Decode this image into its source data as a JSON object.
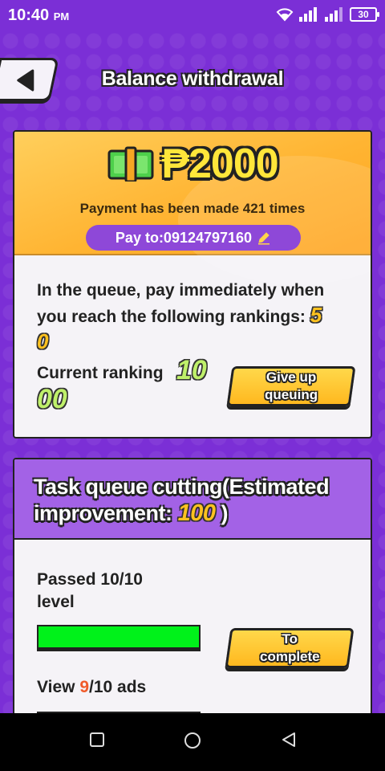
{
  "status_bar": {
    "time": "10:40",
    "ampm": "PM",
    "battery": "30"
  },
  "header": {
    "title": "Balance withdrawal"
  },
  "payment": {
    "amount": "₱2000",
    "count_text": "Payment has been made 421 times",
    "pay_to": "Pay to:09124797160"
  },
  "queue": {
    "text": "In the queue, pay immediately when you reach the following rankings:",
    "target_rank_part1": "5",
    "target_rank_part2": "0",
    "current_label": "Current ranking",
    "current_rank_part1": "10",
    "current_rank_part2": "00",
    "give_up_line1": "Give up",
    "give_up_line2": "queuing"
  },
  "task": {
    "title_text": "Task queue cutting(Estimated improvement:",
    "title_value": "100",
    "title_close": ")",
    "item1_label_line1": "Passed 10/10",
    "item1_label_line2": "level",
    "item1_progress": 1.0,
    "complete_line1": "To",
    "complete_line2": "complete",
    "item2_prefix": "View ",
    "item2_highlight": "9",
    "item2_suffix": "/10 ads",
    "item2_progress": 0.9
  },
  "colors": {
    "background": "#7b2fd6",
    "accent_yellow": "#ffc21f",
    "progress_green": "#00f21a",
    "purple_pill": "#8e48d8",
    "highlight_orange": "#f05a2a"
  },
  "icons": [
    "back-arrow-icon",
    "money-icon",
    "edit-pencil-icon",
    "wifi-icon",
    "signal-icon",
    "battery-icon",
    "nav-recent-icon",
    "nav-home-icon",
    "nav-back-icon"
  ]
}
